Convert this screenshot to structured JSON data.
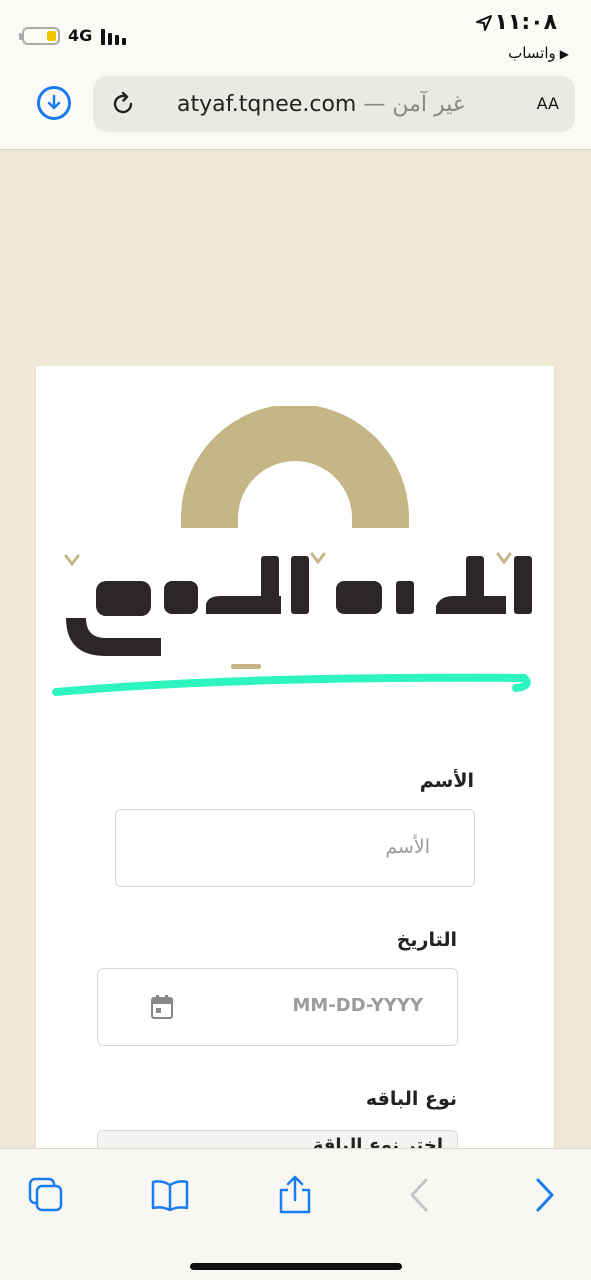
{
  "status": {
    "time": "١١:٠٨",
    "back_app": "واتساب",
    "network": "4G",
    "battery_level": 0.2,
    "signal_bars": 4
  },
  "browser": {
    "url": "atyaf.tqnee.com",
    "security_label": "غير آمن",
    "separator": "—",
    "text_size_label": "AA"
  },
  "logo": {
    "alt_text": "اطياف الكيف",
    "arch_color": "#c5b685",
    "text_color": "#2d2626",
    "underline_color": "#2ef5c0"
  },
  "form": {
    "name_label": "الأسم",
    "name_placeholder": "الأسم",
    "date_label": "التاريخ",
    "date_placeholder": "MM-DD-YYYY",
    "package_label": "نوع الباقه",
    "package_selected": "اختر نوع الباقة"
  },
  "colors": {
    "page_bg": "#efe8d7",
    "accent_blue": "#1a7cf0"
  }
}
